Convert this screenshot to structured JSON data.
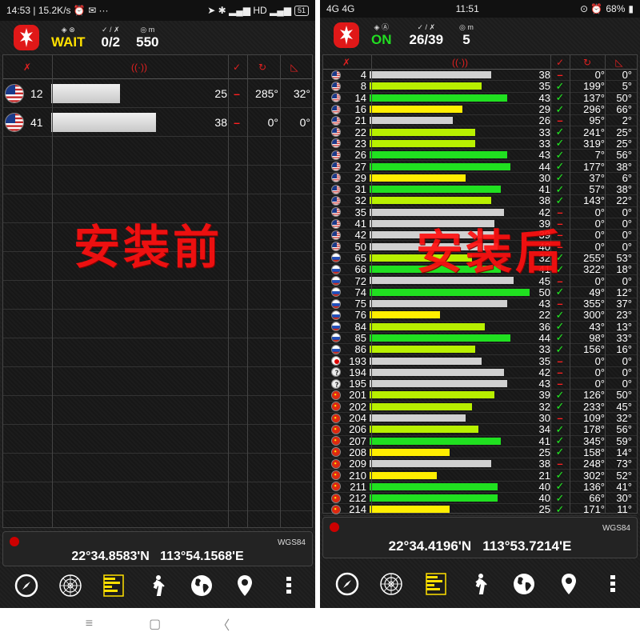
{
  "left": {
    "status": {
      "time": "14:53",
      "speed": "15.2K/s",
      "extra": "···",
      "battery": "51"
    },
    "header": {
      "status": "WAIT",
      "status_color": "#ffe000",
      "sats": "0/2",
      "alt": "550",
      "icons_status": "◈ ⊗",
      "icons_sats": "✓ / ✗",
      "icons_alt": "◎ m"
    },
    "columns": [
      "sat-icon",
      "signal-icon",
      "used-check",
      "azimuth-icon",
      "elevation-icon"
    ],
    "rows": [
      {
        "flag": "us",
        "id": "12",
        "snr": "25",
        "snr_fraction": 0.45,
        "bar_color": "#d8d8d8",
        "used": "–",
        "az": "285°",
        "el": "32°"
      },
      {
        "flag": "us",
        "id": "41",
        "snr": "38",
        "snr_fraction": 0.69,
        "bar_color": "#d8d8d8",
        "used": "–",
        "az": "0°",
        "el": "0°"
      }
    ],
    "watermark": "安装前",
    "footer": {
      "datum": "WGS84",
      "lat": "22°34.8583'N",
      "lon": "113°54.1568'E"
    }
  },
  "right": {
    "status": {
      "left": "4G 4G",
      "time": "11:51",
      "battery": "68%"
    },
    "header": {
      "status": "ON",
      "status_color": "#22dd22",
      "sats": "26/39",
      "alt": "5",
      "icons_status": "◈ Ⓐ",
      "icons_sats": "✓ / ✗",
      "icons_alt": "◎ m"
    },
    "rows": [
      {
        "flag": "us",
        "id": "4",
        "snr": "38",
        "used": "–",
        "az": "0°",
        "el": "0°"
      },
      {
        "flag": "us",
        "id": "8",
        "snr": "35",
        "used": "✓",
        "az": "199°",
        "el": "5°"
      },
      {
        "flag": "us",
        "id": "14",
        "snr": "43",
        "used": "✓",
        "az": "137°",
        "el": "50°"
      },
      {
        "flag": "us",
        "id": "16",
        "snr": "29",
        "used": "✓",
        "az": "296°",
        "el": "66°"
      },
      {
        "flag": "us",
        "id": "21",
        "snr": "26",
        "used": "–",
        "az": "95°",
        "el": "2°"
      },
      {
        "flag": "us",
        "id": "22",
        "snr": "33",
        "used": "✓",
        "az": "241°",
        "el": "25°"
      },
      {
        "flag": "us",
        "id": "23",
        "snr": "33",
        "used": "✓",
        "az": "319°",
        "el": "25°"
      },
      {
        "flag": "us",
        "id": "26",
        "snr": "43",
        "used": "✓",
        "az": "7°",
        "el": "56°"
      },
      {
        "flag": "us",
        "id": "27",
        "snr": "44",
        "used": "✓",
        "az": "177°",
        "el": "38°"
      },
      {
        "flag": "us",
        "id": "29",
        "snr": "30",
        "used": "✓",
        "az": "37°",
        "el": "6°"
      },
      {
        "flag": "us",
        "id": "31",
        "snr": "41",
        "used": "✓",
        "az": "57°",
        "el": "38°"
      },
      {
        "flag": "us",
        "id": "32",
        "snr": "38",
        "used": "✓",
        "az": "143°",
        "el": "22°"
      },
      {
        "flag": "us",
        "id": "35",
        "snr": "42",
        "used": "–",
        "az": "0°",
        "el": "0°"
      },
      {
        "flag": "us",
        "id": "41",
        "snr": "39",
        "used": "–",
        "az": "0°",
        "el": "0°"
      },
      {
        "flag": "us",
        "id": "42",
        "snr": "39",
        "used": "–",
        "az": "0°",
        "el": "0°"
      },
      {
        "flag": "us",
        "id": "50",
        "snr": "40",
        "used": "–",
        "az": "0°",
        "el": "0°"
      },
      {
        "flag": "ru",
        "id": "65",
        "snr": "32",
        "used": "✓",
        "az": "255°",
        "el": "53°"
      },
      {
        "flag": "ru",
        "id": "66",
        "snr": "41",
        "used": "✓",
        "az": "322°",
        "el": "18°"
      },
      {
        "flag": "ru",
        "id": "72",
        "snr": "45",
        "used": "–",
        "az": "0°",
        "el": "0°"
      },
      {
        "flag": "ru",
        "id": "74",
        "snr": "50",
        "used": "✓",
        "az": "49°",
        "el": "12°"
      },
      {
        "flag": "ru",
        "id": "75",
        "snr": "43",
        "used": "–",
        "az": "355°",
        "el": "37°"
      },
      {
        "flag": "ru",
        "id": "76",
        "snr": "22",
        "used": "✓",
        "az": "300°",
        "el": "23°"
      },
      {
        "flag": "ru",
        "id": "84",
        "snr": "36",
        "used": "✓",
        "az": "43°",
        "el": "13°"
      },
      {
        "flag": "ru",
        "id": "85",
        "snr": "44",
        "used": "✓",
        "az": "98°",
        "el": "33°"
      },
      {
        "flag": "ru",
        "id": "86",
        "snr": "33",
        "used": "✓",
        "az": "156°",
        "el": "16°"
      },
      {
        "flag": "jp",
        "id": "193",
        "snr": "35",
        "used": "–",
        "az": "0°",
        "el": "0°"
      },
      {
        "flag": "unknown",
        "id": "194",
        "snr": "42",
        "used": "–",
        "az": "0°",
        "el": "0°"
      },
      {
        "flag": "unknown",
        "id": "195",
        "snr": "43",
        "used": "–",
        "az": "0°",
        "el": "0°"
      },
      {
        "flag": "cn",
        "id": "201",
        "snr": "39",
        "used": "✓",
        "az": "126°",
        "el": "50°"
      },
      {
        "flag": "cn",
        "id": "202",
        "snr": "32",
        "used": "✓",
        "az": "233°",
        "el": "45°"
      },
      {
        "flag": "cn",
        "id": "204",
        "snr": "30",
        "used": "–",
        "az": "109°",
        "el": "32°"
      },
      {
        "flag": "cn",
        "id": "206",
        "snr": "34",
        "used": "✓",
        "az": "178°",
        "el": "56°"
      },
      {
        "flag": "cn",
        "id": "207",
        "snr": "41",
        "used": "✓",
        "az": "345°",
        "el": "59°"
      },
      {
        "flag": "cn",
        "id": "208",
        "snr": "25",
        "used": "✓",
        "az": "158°",
        "el": "14°"
      },
      {
        "flag": "cn",
        "id": "209",
        "snr": "38",
        "used": "–",
        "az": "248°",
        "el": "73°"
      },
      {
        "flag": "cn",
        "id": "210",
        "snr": "21",
        "used": "✓",
        "az": "302°",
        "el": "52°"
      },
      {
        "flag": "cn",
        "id": "211",
        "snr": "40",
        "used": "✓",
        "az": "136°",
        "el": "41°"
      },
      {
        "flag": "cn",
        "id": "212",
        "snr": "40",
        "used": "✓",
        "az": "66°",
        "el": "30°"
      },
      {
        "flag": "cn",
        "id": "214",
        "snr": "25",
        "used": "✓",
        "az": "171°",
        "el": "11°"
      }
    ],
    "watermark": "安装后",
    "footer": {
      "datum": "WGS84",
      "lat": "22°34.4196'N",
      "lon": "113°53.7214'E"
    }
  },
  "toolbar": [
    "compass-icon",
    "radar-icon",
    "signal-bars-icon",
    "walking-icon",
    "globe-icon",
    "location-pin-icon",
    "more-vert-icon"
  ],
  "navbar": {
    "menu": "≡",
    "home": "▢",
    "back": "〈"
  },
  "colors": {
    "bar_used_strong": "#20e020",
    "bar_used_mid": "#b8f000",
    "bar_used_weak": "#ffee00",
    "bar_unused": "#d0d0d0",
    "check": "#22ee22",
    "dash": "#ff2020",
    "accent_red": "#e02020"
  }
}
